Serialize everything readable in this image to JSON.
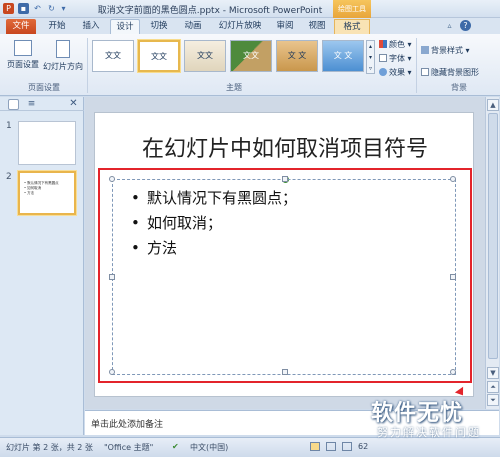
{
  "window": {
    "title": "取消文字前面的黑色圆点.pptx - Microsoft PowerPoint",
    "context_tools": "绘图工具"
  },
  "tabs": [
    "文件",
    "开始",
    "插入",
    "设计",
    "切换",
    "动画",
    "幻灯片放映",
    "审阅",
    "视图",
    "格式"
  ],
  "active_tab": "设计",
  "ribbon": {
    "page_setup_label": "页面设置",
    "orientation_label": "幻灯片方向",
    "group_page_setup": "页面设置",
    "theme_sample": "文文",
    "theme_sample_alt": "文 文",
    "group_themes": "主题",
    "colors_label": "颜色",
    "fonts_label": "字体",
    "effects_label": "效果",
    "bg_style_label": "背景样式",
    "hide_bg_label": "隐藏背景图形",
    "group_background": "背景"
  },
  "slides_panel": {
    "slide_numbers": [
      "1",
      "2"
    ],
    "thumb2_lines": [
      "• 默认情况下有黑圆点",
      "• 如何取消",
      "• 方法"
    ]
  },
  "slide": {
    "title": "在幻灯片中如何取消项目符号",
    "bullets": [
      "默认情况下有黑圆点；",
      "如何取消；",
      "方法"
    ]
  },
  "notes": {
    "placeholder": "单击此处添加备注"
  },
  "status": {
    "slide_info": "幻灯片 第 2 张，共 2 张",
    "theme": "\"Office 主题\"",
    "language": "中文(中国)",
    "zoom": "62"
  },
  "watermark": {
    "main": "软件无忧",
    "sub": "努力解决软件问题"
  },
  "colors": {
    "accent_red": "#e3242b",
    "file_tab": "#c8471f",
    "selection_gold": "#e9b54c"
  }
}
